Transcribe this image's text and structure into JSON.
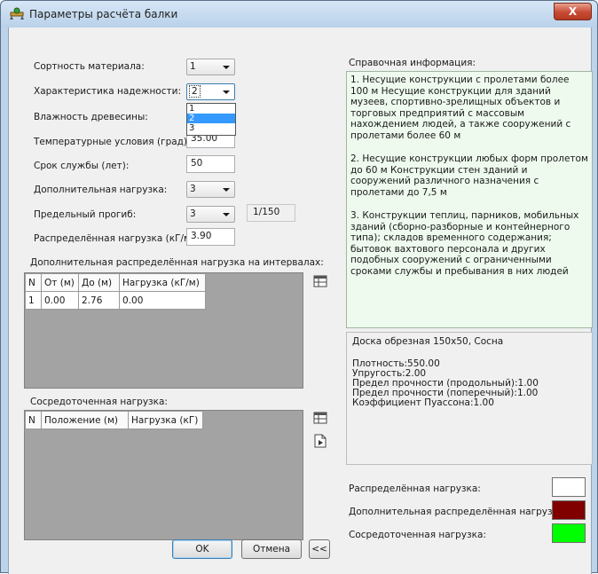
{
  "window": {
    "title": "Параметры расчёта балки",
    "close_label": "X"
  },
  "form": {
    "grade_label": "Сортность материала:",
    "grade_value": "1",
    "reliability_label": "Характеристика надежности:",
    "reliability_value": "2",
    "reliability_options": [
      "1",
      "2",
      "3"
    ],
    "humidity_label": "Влажность древесины:",
    "temperature_label": "Температурные условия (град):",
    "temperature_value": "35.00",
    "service_life_label": "Срок службы (лет):",
    "service_life_value": "50",
    "extra_load_label": "Дополнительная нагрузка:",
    "extra_load_value": "3",
    "deflection_label": "Предельный прогиб:",
    "deflection_value": "3",
    "deflection_ratio": "1/150",
    "distributed_label": "Распределённая нагрузка (кГ/м):",
    "distributed_value": "3.90"
  },
  "interval_table": {
    "caption": "Дополнительная распределённая нагрузка на интервалах:",
    "columns": [
      "N",
      "От (м)",
      "До (м)",
      "Нагрузка (кГ/м)"
    ],
    "rows": [
      [
        "1",
        "0.00",
        "2.76",
        "0.00"
      ]
    ]
  },
  "point_table": {
    "caption": "Сосредоточенная нагрузка:",
    "columns": [
      "N",
      "Положение (м)",
      "Нагрузка (кГ)"
    ]
  },
  "reference": {
    "caption": "Справочная информация:",
    "item1": "1. Несущие конструкции с пролетами более 100 м Несущие конструкции для зданий музеев, спортивно-зрелищных объектов и торговых предприятий с массовым нахождением людей, а также сооружений с пролетами более 60 м",
    "item2": "2. Несущие конструкции любых форм пролетом до 60 м Конструкции стен зданий и сооружений различного назначения с пролетами до 7,5 м",
    "item3": "3. Конструкции теплиц, парников, мобильных зданий (сборно-разборные и контейнерного типа); складов временного содержания; бытовок вахтового персонала и других подобных сооружений с ограниченными сроками службы и пребывания в них людей"
  },
  "material": {
    "name": "Доска обрезная 150x50, Сосна",
    "density": "Плотность:550.00",
    "elasticity": "Упругость:2.00",
    "strength_long": "Предел прочности (продольный):1.00",
    "strength_cross": "Предел прочности (поперечный):1.00",
    "poisson": "Коэффициент Пуассона:1.00"
  },
  "legend": {
    "distributed": "Распределённая нагрузка:",
    "distributed_color": "#ffffff",
    "additional": "Дополнительная распределённая нагрузка:",
    "additional_color": "#800000",
    "point": "Сосредоточенная нагрузка:",
    "point_color": "#00ff00"
  },
  "buttons": {
    "ok": "OK",
    "cancel": "Отмена",
    "collapse": "<<"
  },
  "icons": [
    "beam-icon",
    "grid-edit-icon",
    "grid-edit-icon",
    "page-arrow-icon"
  ]
}
